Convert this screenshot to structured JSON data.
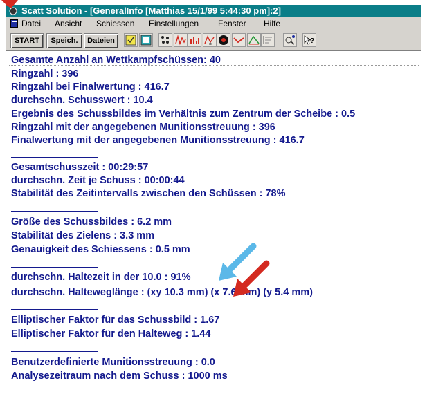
{
  "window": {
    "title": "Scatt Solution - [GeneralInfo [Matthias 15/1/99 5:44:30 pm]:2]"
  },
  "menu": {
    "items": [
      {
        "label": "Datei"
      },
      {
        "label": "Ansicht"
      },
      {
        "label": "Schiessen"
      },
      {
        "label": "Einstellungen"
      },
      {
        "label": "Fenster"
      },
      {
        "label": "Hilfe"
      }
    ]
  },
  "toolbar": {
    "start_label": "START",
    "save_label": "Speich.",
    "files_label": "Dateien",
    "icons": [
      "statistics-icon",
      "grid-icon",
      "dots-icon",
      "histogram-icon",
      "bar-chart-icon",
      "xy-chart-icon",
      "target-icon",
      "trace-icon",
      "line-chart-icon",
      "list-chart-icon",
      "zoom-icon",
      "help-icon"
    ]
  },
  "info": {
    "lines": [
      "Gesamte Anzahl an Wettkampfschüssen: 40",
      "Ringzahl : 396",
      "Ringzahl bei Finalwertung : 416.7",
      "durchschn. Schusswert : 10.4",
      "Ergebnis des Schussbildes im Verhältnis zum Zentrum der Scheibe :   0.5",
      "Ringzahl mit der angegebenen Munitionsstreuung : 396",
      "Finalwertung mit der angegebenen Munitionsstreuung : 416.7",
      "Gesamtschusszeit : 00:29:57",
      "durchschn. Zeit je Schuss : 00:00:44",
      "Stabilität des Zeitintervalls zwischen den Schüssen : 78%",
      "Größe des Schussbildes :  6.2 mm",
      "Stabilität des Zielens :  3.3 mm",
      "Genauigkeit des Schiessens :  0.5 mm",
      "durchschn. Haltezeit in der 10.0 : 91%",
      "durchschn. Halteweglänge : (xy   10.3 mm) (x    7.6 mm) (y    5.4 mm)",
      "Elliptischer Faktor für das Schussbild : 1.67",
      "Elliptischer Faktor für den Halteweg : 1.44",
      "Benutzerdefinierte Munitionsstreuung :  0.0",
      "Analysezeitraum nach dem Schuss : 1000 ms"
    ]
  },
  "colors": {
    "title_bar": "#0b7e88",
    "text": "#141a8e",
    "arrow_blue": "#5bb8e8",
    "arrow_red": "#d42a20"
  }
}
